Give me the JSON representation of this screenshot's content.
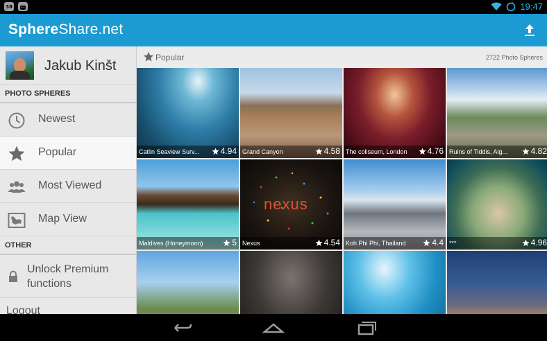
{
  "status_bar": {
    "time": "19:47",
    "left_icons": [
      "notification-badge-icon",
      "android-icon"
    ],
    "badge_text": "38",
    "right_icons": [
      "wifi-icon",
      "sync-icon"
    ]
  },
  "action_bar": {
    "brand_bold": "Sphere",
    "brand_light": "Share.net",
    "upload_icon": "upload-icon",
    "color": "#1b9bd1"
  },
  "sidebar": {
    "profile": {
      "name": "Jakub Kinšt"
    },
    "section_photo_spheres": "PHOTO SPHERES",
    "items": [
      {
        "label": "Newest",
        "icon": "clock-icon",
        "active": false
      },
      {
        "label": "Popular",
        "icon": "star-icon",
        "active": true
      },
      {
        "label": "Most Viewed",
        "icon": "group-icon",
        "active": false
      },
      {
        "label": "Map View",
        "icon": "map-icon",
        "active": false
      }
    ],
    "section_other": "OTHER",
    "unlock": {
      "label": "Unlock Premium functions",
      "icon": "lock-icon"
    },
    "logout": {
      "label": "Logout"
    }
  },
  "content": {
    "title": "Popular",
    "count": "2722 Photo Spheres",
    "tiles": [
      {
        "name": "Catlin Seaview Surv...",
        "rating": "4.94"
      },
      {
        "name": "Grand Canyon",
        "rating": "4.58"
      },
      {
        "name": "The coliseum, London",
        "rating": "4.76"
      },
      {
        "name": "Ruins of Tiddis, Alg...",
        "rating": "4.82"
      },
      {
        "name": "Maldives (Honeymoon)",
        "rating": "5"
      },
      {
        "name": "Nexus",
        "rating": "4.54"
      },
      {
        "name": "Koh Phi Phi, Thailand",
        "rating": "4.4"
      },
      {
        "name": "***",
        "rating": "4.96"
      },
      {
        "name": "",
        "rating": ""
      },
      {
        "name": "",
        "rating": ""
      },
      {
        "name": "",
        "rating": ""
      },
      {
        "name": "",
        "rating": ""
      }
    ],
    "nexus_overlay_text": "nexus"
  },
  "nav_bar": {
    "buttons": [
      "back-icon",
      "home-icon",
      "recents-icon"
    ]
  }
}
